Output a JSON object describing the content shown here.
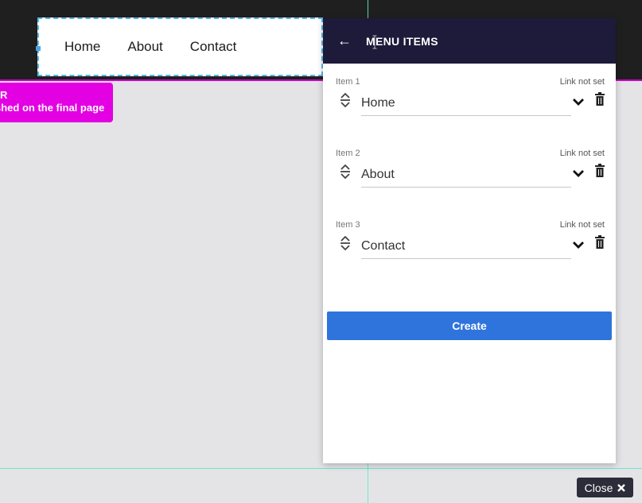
{
  "nav_preview": {
    "items": [
      "Home",
      "About",
      "Contact"
    ]
  },
  "tag": {
    "line1": "R",
    "line2": "shed on the final page"
  },
  "panel": {
    "back_icon": "arrow-left-icon",
    "title": "MENU ITEMS",
    "items": [
      {
        "label": "Item 1",
        "link": "Link not set",
        "value": "Home"
      },
      {
        "label": "Item 2",
        "link": "Link not set",
        "value": "About"
      },
      {
        "label": "Item 3",
        "link": "Link not set",
        "value": "Contact"
      }
    ],
    "create_label": "Create"
  },
  "footer": {
    "close_label": "Close",
    "close_icon": "x-icon"
  },
  "colors": {
    "accent": "#2f74dd",
    "header": "#1d1a3a",
    "tag": "#e300e3",
    "guide": "#5ee8c8"
  }
}
